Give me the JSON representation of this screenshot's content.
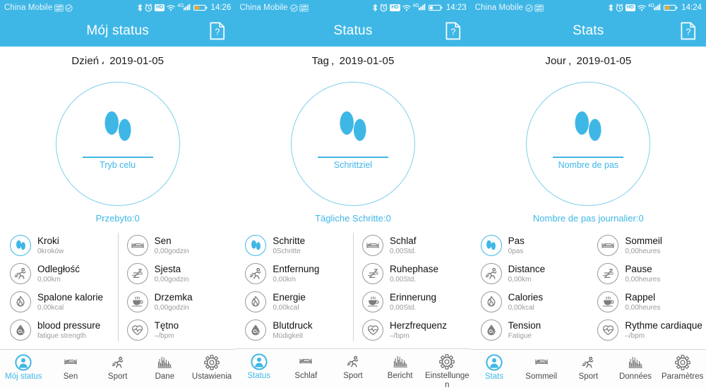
{
  "colors": {
    "brand_blue": "#3fb7e6",
    "circle_outline": "#7fd0ec",
    "icon_gray": "#9a9a9a",
    "value_gray": "#9b9b9b",
    "label_black": "#111111"
  },
  "panels": [
    {
      "statusbar": {
        "carrier": "China Mobile",
        "hd_badge": "HD",
        "network_type": "4G",
        "time": "14:26",
        "icons": [
          "data-arrows-icon",
          "check-circle-icon",
          "bluetooth-icon",
          "alarm-clock-icon",
          "hd-icon",
          "wifi-icon",
          "signal-bars-icon",
          "battery-icon"
        ]
      },
      "header": {
        "title": "Mój status",
        "help_label": "?"
      },
      "date": {
        "prefix": "Dzień",
        "separator": "،",
        "value": "2019-01-05"
      },
      "circle": {
        "goal_label": "Tryb celu"
      },
      "total": "Przebyto:0",
      "metrics_left": [
        {
          "icon": "footsteps-icon",
          "label": "Kroki",
          "value": "0kroków",
          "active": true
        },
        {
          "icon": "running-person-icon",
          "label": "Odległość",
          "value": "0,00km",
          "active": false
        },
        {
          "icon": "flame-icon",
          "label": "Spalone kalorie",
          "value": "0,00kcal",
          "active": false
        },
        {
          "icon": "blood-drop-icon",
          "label": "blood pressure",
          "value": "fatigue strength",
          "active": false
        }
      ],
      "metrics_right": [
        {
          "icon": "bed-icon",
          "label": "Sen",
          "value": "0,00godzin",
          "active": false
        },
        {
          "icon": "zzz-icon",
          "label": "Sjesta",
          "value": "0,00godzin",
          "active": false
        },
        {
          "icon": "coffee-cup-icon",
          "label": "Drzemka",
          "value": "0,00godzin",
          "active": false
        },
        {
          "icon": "heart-pulse-icon",
          "label": "Tętno",
          "value": "–/bpm",
          "active": false
        }
      ],
      "nav": [
        {
          "icon": "person-icon",
          "label": "Mój status",
          "active": true
        },
        {
          "icon": "bed-icon",
          "label": "Sen",
          "active": false
        },
        {
          "icon": "running-person-icon",
          "label": "Sport",
          "active": false
        },
        {
          "icon": "bar-chart-icon",
          "label": "Dane",
          "active": false
        },
        {
          "icon": "gear-icon",
          "label": "Ustawienia",
          "active": false
        }
      ]
    },
    {
      "statusbar": {
        "carrier": "China Mobile",
        "hd_badge": "HD",
        "network_type": "4G",
        "time": "14:23",
        "icons": [
          "check-circle-icon",
          "data-arrows-icon",
          "bluetooth-icon",
          "alarm-clock-icon",
          "hd-icon",
          "wifi-icon",
          "signal-bars-icon",
          "battery-icon"
        ]
      },
      "header": {
        "title": "Status",
        "help_label": "?"
      },
      "date": {
        "prefix": "Tag",
        "separator": ",",
        "value": "2019-01-05"
      },
      "circle": {
        "goal_label": "Schrittziel"
      },
      "total": "Tägliche Schritte:0",
      "metrics_left": [
        {
          "icon": "footsteps-icon",
          "label": "Schritte",
          "value": "0Schritte",
          "active": true
        },
        {
          "icon": "running-person-icon",
          "label": "Entfernung",
          "value": "0,00km",
          "active": false
        },
        {
          "icon": "flame-icon",
          "label": "Energie",
          "value": "0,00kcal",
          "active": false
        },
        {
          "icon": "blood-drop-icon",
          "label": "Blutdruck",
          "value": "Müdigkeit",
          "active": false
        }
      ],
      "metrics_right": [
        {
          "icon": "bed-icon",
          "label": "Schlaf",
          "value": "0,00Std.",
          "active": false
        },
        {
          "icon": "zzz-icon",
          "label": "Ruhephase",
          "value": "0,00Std.",
          "active": false
        },
        {
          "icon": "coffee-cup-icon",
          "label": "Erinnerung",
          "value": "0,00Std.",
          "active": false
        },
        {
          "icon": "heart-pulse-icon",
          "label": "Herzfrequenz",
          "value": "–/bpm",
          "active": false
        }
      ],
      "nav": [
        {
          "icon": "person-icon",
          "label": "Status",
          "active": true
        },
        {
          "icon": "bed-icon",
          "label": "Schlaf",
          "active": false
        },
        {
          "icon": "running-person-icon",
          "label": "Sport",
          "active": false
        },
        {
          "icon": "bar-chart-icon",
          "label": "Bericht",
          "active": false
        },
        {
          "icon": "gear-icon",
          "label": "Einstellungen",
          "active": false
        }
      ]
    },
    {
      "statusbar": {
        "carrier": "China Mobile",
        "hd_badge": "HD",
        "network_type": "4G",
        "time": "14:24",
        "icons": [
          "check-circle-icon",
          "data-arrows-icon",
          "bluetooth-icon",
          "alarm-clock-icon",
          "hd-icon",
          "wifi-icon",
          "signal-bars-icon",
          "battery-icon"
        ]
      },
      "header": {
        "title": "Stats",
        "help_label": "?"
      },
      "date": {
        "prefix": "Jour",
        "separator": ",",
        "value": "2019-01-05"
      },
      "circle": {
        "goal_label": "Nombre de pas"
      },
      "total": "Nombre de pas journalier:0",
      "metrics_left": [
        {
          "icon": "footsteps-icon",
          "label": "Pas",
          "value": "0pas",
          "active": true
        },
        {
          "icon": "running-person-icon",
          "label": "Distance",
          "value": "0,00km",
          "active": false
        },
        {
          "icon": "flame-icon",
          "label": "Calories",
          "value": "0,00kcal",
          "active": false
        },
        {
          "icon": "blood-drop-icon",
          "label": "Tension",
          "value": "Fatigue",
          "active": false
        }
      ],
      "metrics_right": [
        {
          "icon": "bed-icon",
          "label": "Sommeil",
          "value": "0,00heures",
          "active": false
        },
        {
          "icon": "zzz-icon",
          "label": "Pause",
          "value": "0,00heures",
          "active": false
        },
        {
          "icon": "coffee-cup-icon",
          "label": "Rappel",
          "value": "0,00heures",
          "active": false
        },
        {
          "icon": "heart-pulse-icon",
          "label": "Rythme cardiaque",
          "value": "–/bpm",
          "active": false
        }
      ],
      "nav": [
        {
          "icon": "person-icon",
          "label": "Stats",
          "active": true
        },
        {
          "icon": "bed-icon",
          "label": "Sommeil",
          "active": false
        },
        {
          "icon": "running-person-icon",
          "label": "Sport",
          "active": false
        },
        {
          "icon": "bar-chart-icon",
          "label": "Données",
          "active": false
        },
        {
          "icon": "gear-icon",
          "label": "Paramètres",
          "active": false
        }
      ]
    }
  ]
}
